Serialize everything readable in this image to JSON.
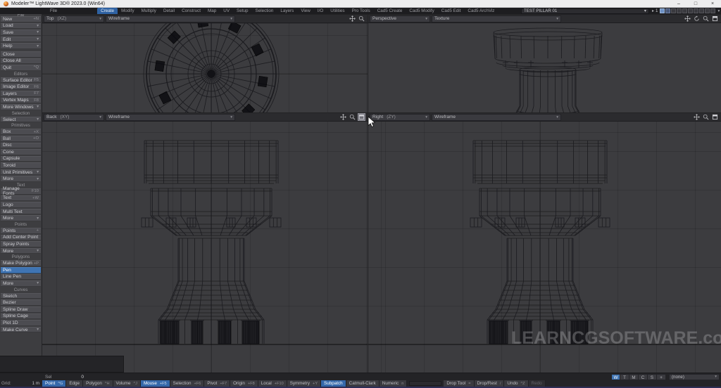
{
  "window": {
    "title": "Modeler™ LightWave 3D® 2023.0 (Win64)"
  },
  "menu": {
    "tabs": [
      {
        "label": "File"
      },
      {
        "label": "Create",
        "active": true
      },
      {
        "label": "Modify"
      },
      {
        "label": "Multiply"
      },
      {
        "label": "Detail"
      },
      {
        "label": "Construct"
      },
      {
        "label": "Map"
      },
      {
        "label": "UV"
      },
      {
        "label": "Setup"
      },
      {
        "label": "Selection"
      },
      {
        "label": "Layers"
      },
      {
        "label": "View"
      },
      {
        "label": "I/O"
      },
      {
        "label": "Utilities"
      },
      {
        "label": "Pro Tools"
      },
      {
        "label": "Cad5 Create"
      },
      {
        "label": "Cad5 Modify"
      },
      {
        "label": "Cad5 Edit"
      },
      {
        "label": "Cad5 ArchViz"
      }
    ],
    "object_selector": "TEST PILLAR 01",
    "layer_arrow": "▸",
    "layer_number": "1",
    "layer_cells": [
      "bright",
      "mid",
      "",
      "",
      "",
      "",
      "",
      "",
      "",
      ""
    ]
  },
  "sidebar": {
    "sections": [
      {
        "header": "File",
        "items": [
          {
            "label": "New",
            "shortcut": "+N"
          },
          {
            "label": "Load",
            "chevron": true
          },
          {
            "label": "Save",
            "chevron": true
          },
          {
            "label": "Edit",
            "chevron": true
          },
          {
            "label": "Help",
            "chevron": true
          }
        ]
      },
      {
        "header": null,
        "items": [
          {
            "label": "Close"
          },
          {
            "label": "Close All"
          },
          {
            "label": "Quit",
            "shortcut": "^Q"
          }
        ]
      },
      {
        "header": "Editors",
        "items": [
          {
            "label": "Surface Editor",
            "shortcut": "F5"
          },
          {
            "label": "Image Editor",
            "shortcut": "F6"
          },
          {
            "label": "Layers",
            "shortcut": "F7"
          },
          {
            "label": "Vertex Maps",
            "shortcut": "F8"
          },
          {
            "label": "More Windows",
            "chevron": true
          }
        ]
      },
      {
        "header": "Selection",
        "items": [
          {
            "label": "Select",
            "chevron": true
          }
        ]
      },
      {
        "header": "Primitives",
        "items": [
          {
            "label": "Box",
            "shortcut": "+X"
          },
          {
            "label": "Ball",
            "shortcut": "+O"
          },
          {
            "label": "Disc"
          },
          {
            "label": "Cone"
          },
          {
            "label": "Capsule"
          },
          {
            "label": "Toroid"
          },
          {
            "label": "Unit Primitives",
            "chevron": true
          },
          {
            "label": "More",
            "chevron": true
          }
        ]
      },
      {
        "header": "Text",
        "items": [
          {
            "label": "Manage Fonts",
            "shortcut": "F10"
          },
          {
            "label": "Text",
            "shortcut": "+W"
          },
          {
            "label": "Logo"
          },
          {
            "label": "Multi Text"
          },
          {
            "label": "More",
            "chevron": true
          }
        ]
      },
      {
        "header": "Points",
        "items": [
          {
            "label": "Points",
            "shortcut": "+"
          },
          {
            "label": "Add Center Point"
          },
          {
            "label": "Spray Points"
          },
          {
            "label": "More",
            "chevron": true
          }
        ]
      },
      {
        "header": "Polygons",
        "items": [
          {
            "label": "Make Polygon",
            "shortcut": "+P"
          },
          {
            "label": "Pen",
            "selected": true
          },
          {
            "label": "Line Pen"
          },
          {
            "label": "More",
            "chevron": true
          }
        ]
      },
      {
        "header": "Curves",
        "items": [
          {
            "label": "Sketch"
          },
          {
            "label": "Bezier"
          },
          {
            "label": "Spline Draw"
          },
          {
            "label": "Spline Cage"
          },
          {
            "label": "Plot 1D"
          },
          {
            "label": "Make Curve",
            "chevron": true
          }
        ]
      }
    ]
  },
  "viewports": [
    {
      "name": "top",
      "label": "Top",
      "axis": "(XZ)",
      "mode": "Wireframe",
      "icons": [
        "pan-icon",
        "zoom-icon"
      ]
    },
    {
      "name": "perspective",
      "label": "Perspective",
      "axis": "",
      "mode": "Texture",
      "icons": [
        "pan-icon",
        "rotate-icon",
        "zoom-icon",
        "expand-icon"
      ]
    },
    {
      "name": "back",
      "label": "Back",
      "axis": "(XY)",
      "mode": "Wireframe",
      "icons": [
        "pan-icon",
        "zoom-icon",
        "expand-icon"
      ],
      "highlighted_icon": "expand-icon"
    },
    {
      "name": "right",
      "label": "Right",
      "axis": "(ZY)",
      "mode": "Wireframe",
      "icons": [
        "pan-icon",
        "zoom-icon",
        "expand-icon"
      ]
    }
  ],
  "statusbar": {
    "sel_label": "Sel",
    "sel_value": "0",
    "grid_label": "Grid:",
    "grid_value": "1 m",
    "view_modes": [
      "W",
      "T",
      "M",
      "C",
      "S",
      "+"
    ],
    "active_view_mode": "W",
    "preset_dropdown": "(none)",
    "mode_buttons": [
      {
        "label": "Point",
        "shortcut": "^G",
        "active": true
      },
      {
        "label": "Edge"
      },
      {
        "label": "Polygon",
        "shortcut": "^H"
      },
      {
        "label": "Volume",
        "shortcut": "^J"
      },
      {
        "label": "Mouse",
        "shortcut": "+F5",
        "active": true
      },
      {
        "label": "Selection",
        "shortcut": "+F6"
      },
      {
        "label": "Pivot",
        "shortcut": "+F7"
      },
      {
        "label": "Origin",
        "shortcut": "+F8"
      },
      {
        "label": "Local",
        "shortcut": "+F10"
      },
      {
        "label": "Symmetry",
        "shortcut": "+Y"
      },
      {
        "label": "Subpatch",
        "active": true
      },
      {
        "label": "Catmull-Clark"
      },
      {
        "label": "Numeric",
        "shortcut": "n"
      },
      {
        "type": "input",
        "value": ""
      },
      {
        "label": "Drop Tool",
        "shortcut": "="
      },
      {
        "label": "Drop/Rest",
        "shortcut": "/"
      },
      {
        "label": "Undo",
        "shortcut": "^Z"
      },
      {
        "label": "Redo",
        "disabled": true
      }
    ]
  },
  "watermark": {
    "text": "LEARNCGSOFTWARE.com"
  }
}
